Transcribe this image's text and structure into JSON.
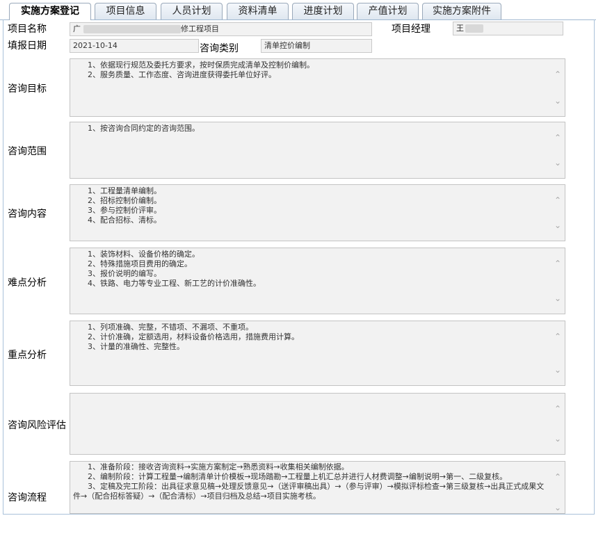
{
  "tabs": [
    {
      "label": "实施方案登记"
    },
    {
      "label": "项目信息"
    },
    {
      "label": "人员计划"
    },
    {
      "label": "资料清单"
    },
    {
      "label": "进度计划"
    },
    {
      "label": "产值计划"
    },
    {
      "label": "实施方案附件"
    }
  ],
  "header": {
    "project_name_label": "项目名称",
    "project_name_prefix": "广",
    "project_name_value": "修工程项目",
    "manager_label": "项目经理",
    "manager_value": "王",
    "fill_date_label": "填报日期",
    "fill_date_value": "2021-10-14",
    "consult_type_label": "咨询类别",
    "consult_type_value": "清单控价编制"
  },
  "sections": [
    {
      "label": "咨询目标",
      "lines": [
        "      1、依据现行规范及委托方要求，按时保质完成清单及控制价编制。",
        "      2、服务质量、工作态度、咨询进度获得委托单位好评。"
      ]
    },
    {
      "label": "咨询范围",
      "lines": [
        "      1、按咨询合同约定的咨询范围。"
      ]
    },
    {
      "label": "咨询内容",
      "lines": [
        "      1、工程量清单编制。",
        "      2、招标控制价编制。",
        "      3、参与控制价评审。",
        "      4、配合招标、清标。"
      ]
    },
    {
      "label": "难点分析",
      "lines": [
        "      1、装饰材料、设备价格的确定。",
        "      2、特殊措施项目费用的确定。",
        "      3、报价说明的编写。",
        "      4、铁路、电力等专业工程、新工艺的计价准确性。"
      ]
    },
    {
      "label": "重点分析",
      "lines": [
        "      1、列项准确、完整，不错项、不漏项、不重项。",
        "      2、计价准确，定额选用，材料设备价格选用，措施费用计算。",
        "      3、计量的准确性、完整性。"
      ]
    },
    {
      "label": "咨询风险评估",
      "lines": []
    },
    {
      "label": "咨询流程",
      "lines": [
        "      1、准备阶段：接收咨询资料→实施方案制定→熟悉资料→收集相关编制依据。",
        "      2、编制阶段：计算工程量→编制清单计价模板→现场踏勘→工程量上机汇总并进行人材费调整→编制说明→第一、二级复核。",
        "      3、定稿及完工阶段：出具征求意见稿→处理反馈意见→（送评审稿出具）→（参与评审）→模拟评标检查→第三级复核→出具正式成果文件→（配合招标答疑）→（配合清标）→项目归档及总结→项目实施考核。"
      ]
    }
  ],
  "icons": {
    "scroll_up": "chevron-up-icon",
    "scroll_down": "chevron-down-icon"
  }
}
